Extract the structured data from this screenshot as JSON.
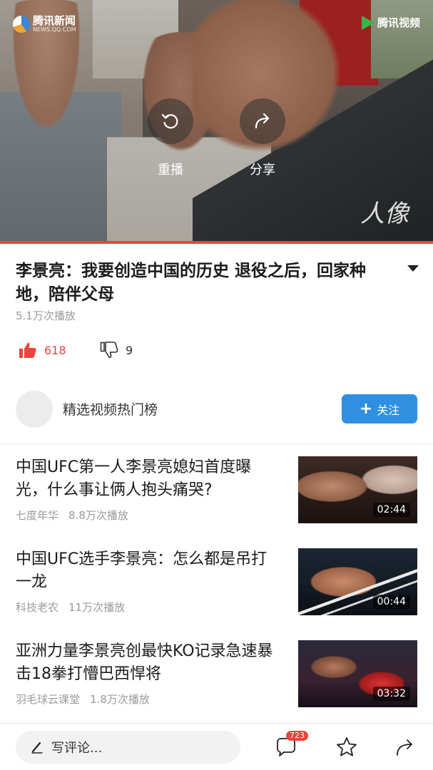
{
  "video": {
    "logo_left_title": "腾讯新闻",
    "logo_left_sub": "NEWS.QQ.COM",
    "logo_right_title": "腾讯视频",
    "logo_right_sub": "",
    "replay_label": "重播",
    "share_label": "分享",
    "watermark": "人像"
  },
  "article": {
    "title": "李景亮：我要创造中国的历史 退役之后，回家种地，陪伴父母",
    "plays": "5.1万次播放",
    "likes": "618",
    "dislikes": "9"
  },
  "channel": {
    "name": "精选视频热门榜",
    "follow_label": "关注"
  },
  "recommendations": [
    {
      "title": "中国UFC第一人李景亮媳妇首度曝光，什么事让俩人抱头痛哭?",
      "source": "七度年华",
      "plays": "8.8万次播放",
      "duration": "02:44"
    },
    {
      "title": "中国UFC选手李景亮：怎么都是吊打一龙",
      "source": "科技老农",
      "plays": "11万次播放",
      "duration": "00:44"
    },
    {
      "title": "亚洲力量李景亮创最快KO记录急速暴击18拳打懵巴西悍将",
      "source": "羽毛球云课堂",
      "plays": "1.8万次播放",
      "duration": "03:32"
    }
  ],
  "bottom_bar": {
    "comment_placeholder": "写评论...",
    "comment_count": "723"
  },
  "colors": {
    "accent_red": "#e8453c",
    "follow_blue": "#2f8fe0"
  }
}
